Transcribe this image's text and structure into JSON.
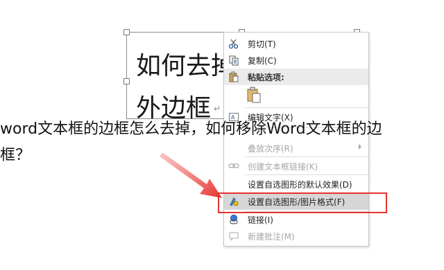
{
  "document": {
    "textbox_line1": "如何去掉",
    "textbox_line2": "外边框",
    "paragraph_mark": "↵"
  },
  "context_menu": {
    "items": [
      {
        "label": "剪切(T)",
        "icon": "scissors-icon",
        "enabled": true
      },
      {
        "label": "复制(C)",
        "icon": "copy-icon",
        "enabled": true
      },
      {
        "label": "粘贴选项:",
        "icon": "paste-icon",
        "enabled": true,
        "header": true
      },
      {
        "label": "",
        "icon": "paste-keep-text-icon",
        "enabled": true
      },
      {
        "label": "编辑文字(X)",
        "icon": "edit-text-icon",
        "enabled": true
      },
      {
        "label": "叠放次序(R)",
        "icon": "",
        "enabled": false,
        "submenu": true
      },
      {
        "label": "创建文本框链接(K)",
        "icon": "link-textbox-icon",
        "enabled": false
      },
      {
        "label": "设置自选图形的默认效果(D)",
        "icon": "",
        "enabled": true
      },
      {
        "label": "设置自选图形/图片格式(F)",
        "icon": "format-shape-icon",
        "enabled": true,
        "highlighted": true
      },
      {
        "label": "链接(I)",
        "icon": "hyperlink-icon",
        "enabled": true
      },
      {
        "label": "新建批注(M)",
        "icon": "comment-icon",
        "enabled": false
      }
    ]
  },
  "caption": {
    "line1": "word文本框的边框怎么去掉，如何移除Word文本框的边",
    "line2": "框？"
  },
  "colors": {
    "highlight": "#e5322d",
    "menu_bg": "#ffffff",
    "menu_hover": "#d6d6d6"
  }
}
